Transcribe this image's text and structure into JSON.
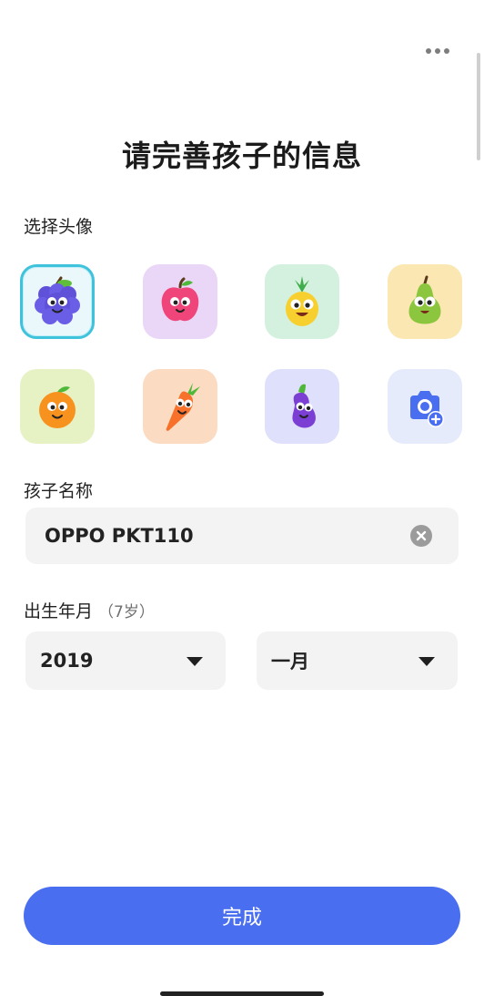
{
  "header": {
    "title": "请完善孩子的信息",
    "more_icon": "more-horizontal-icon"
  },
  "avatar_section": {
    "label": "选择头像",
    "selected_index": 0,
    "items": [
      {
        "name": "grape",
        "bg": "#eaf7fb"
      },
      {
        "name": "apple",
        "bg": "#ead7f7"
      },
      {
        "name": "pineapple",
        "bg": "#d4f1df"
      },
      {
        "name": "pear",
        "bg": "#fbe7b2"
      },
      {
        "name": "orange",
        "bg": "#e6f2c3"
      },
      {
        "name": "carrot",
        "bg": "#fbdcc2"
      },
      {
        "name": "eggplant",
        "bg": "#dfe0fb"
      },
      {
        "name": "add-photo",
        "bg": "#e6ebfb"
      }
    ]
  },
  "name_section": {
    "label": "孩子名称",
    "value": "OPPO PKT110",
    "clear_icon": "clear-circle-icon"
  },
  "birth_section": {
    "label": "出生年月",
    "age": "（7岁）",
    "year": "2019",
    "month": "一月"
  },
  "submit_label": "完成",
  "colors": {
    "primary": "#4a6ef0",
    "selected_border": "#3fc3dd",
    "field_bg": "#f3f3f3"
  }
}
